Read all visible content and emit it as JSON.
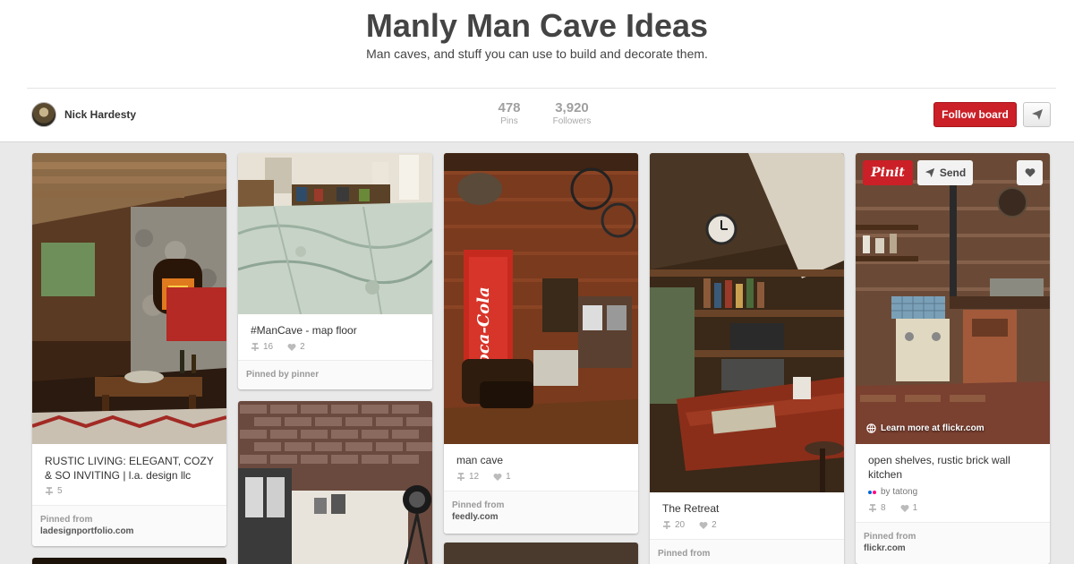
{
  "board": {
    "title": "Manly Man Cave Ideas",
    "description": "Man caves, and stuff you can use to build and decorate them.",
    "owner": "Nick Hardesty",
    "pins_count": "478",
    "pins_label": "Pins",
    "followers_count": "3,920",
    "followers_label": "Followers",
    "follow_label": "Follow board"
  },
  "pins": [
    {
      "description": "RUSTIC LIVING: ELEGANT, COZY & SO INVITING | l.a. design llc",
      "repins": "5",
      "footer_label": "Pinned from",
      "footer_source": "ladesignportfolio.com"
    },
    {
      "description": "#ManCave - map floor",
      "repins": "16",
      "likes": "2",
      "footer_label": "Pinned by pinner"
    },
    {
      "description": "man cave",
      "repins": "12",
      "likes": "1",
      "footer_label": "Pinned from",
      "footer_source": "feedly.com"
    },
    {
      "description": "The Retreat",
      "repins": "20",
      "likes": "2",
      "footer_label": "Pinned from"
    },
    {
      "pinit_label": "Pinit",
      "send_label": "Send",
      "learn_more": "Learn more at flickr.com",
      "description": "open shelves, rustic brick wall kitchen",
      "via": "by tatong",
      "repins": "8",
      "likes": "1",
      "footer_label": "Pinned from",
      "footer_source": "flickr.com"
    }
  ],
  "colors": {
    "accent": "#cb2027",
    "background": "#e9e9e9"
  },
  "icons": {
    "repin": "repin-icon",
    "like": "heart-icon",
    "send": "paper-plane-icon",
    "globe": "globe-icon"
  }
}
